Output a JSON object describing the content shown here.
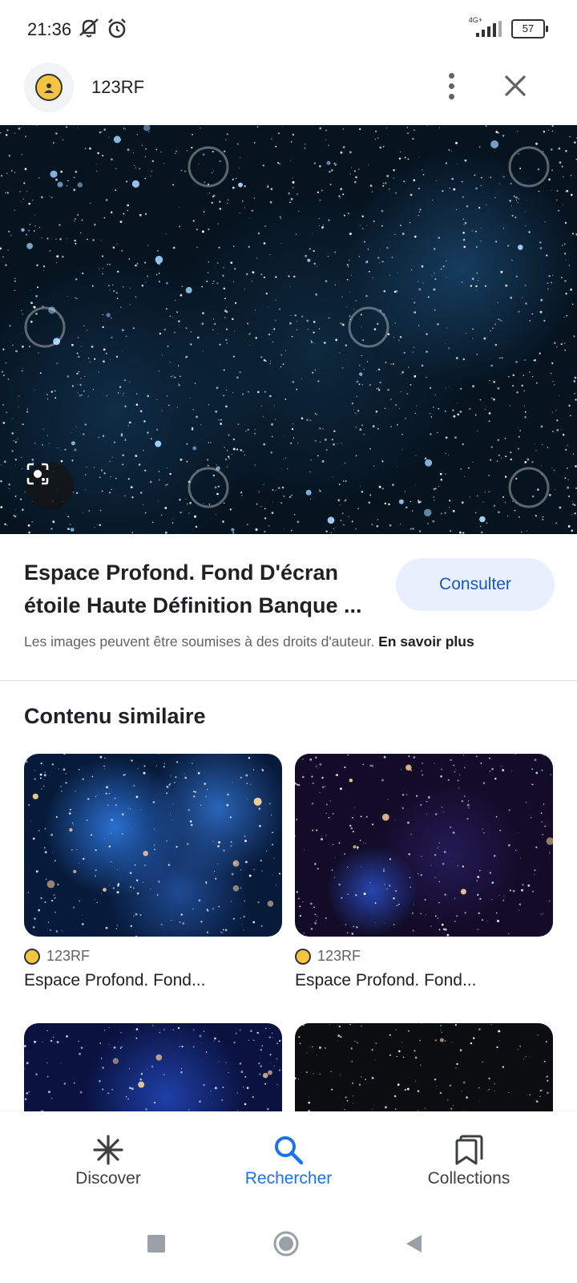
{
  "status_bar": {
    "time": "21:36",
    "network": "4G+",
    "battery": "57",
    "icons": [
      "mute-icon",
      "alarm-icon",
      "signal-icon",
      "battery-icon"
    ]
  },
  "header": {
    "site_name": "123RF",
    "icons": [
      "site-logo-icon",
      "more-vert-icon",
      "close-icon"
    ]
  },
  "image": {
    "watermark": "123RF",
    "lens_icon": "google-lens-icon"
  },
  "result": {
    "title_line1": "Espace Profond. Fond D'écran",
    "title_line2": "étoile Haute Définition Banque ...",
    "consult_label": "Consulter",
    "copyright_text": "Les images peuvent être soumises à des droits d'auteur.",
    "learn_more": "En savoir plus"
  },
  "similar": {
    "heading": "Contenu similaire",
    "cards": [
      {
        "source": "123RF",
        "title": "Espace Profond. Fond..."
      },
      {
        "source": "123RF",
        "title": "Espace Profond. Fond..."
      },
      {
        "source": "",
        "title": ""
      },
      {
        "source": "",
        "title": ""
      }
    ]
  },
  "bottom_nav": {
    "items": [
      {
        "label": "Discover",
        "icon": "asterisk-icon",
        "active": false
      },
      {
        "label": "Rechercher",
        "icon": "search-icon",
        "active": true
      },
      {
        "label": "Collections",
        "icon": "collections-icon",
        "active": false
      }
    ]
  },
  "colors": {
    "accent": "#1a73e8",
    "consult_bg": "#e8f0fe",
    "text": "#202124",
    "secondary_text": "#5f6368"
  }
}
